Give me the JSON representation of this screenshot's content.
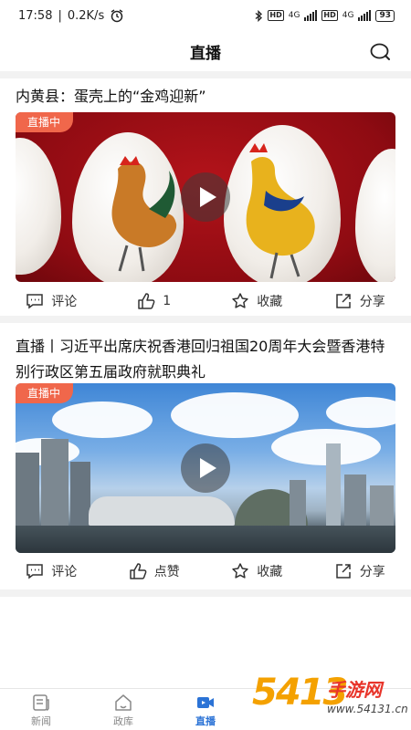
{
  "status_bar": {
    "time": "17:58",
    "speed": "0.2K/s",
    "network": "4G",
    "hd": "HD",
    "battery": "93"
  },
  "header": {
    "title": "直播",
    "search_icon": "search-icon"
  },
  "cards": [
    {
      "title": "内黄县：蛋壳上的“金鸡迎新”",
      "badge": "直播中",
      "actions": [
        {
          "label": "评论",
          "icon": "comment-icon"
        },
        {
          "label": "1",
          "icon": "thumbs-up-icon"
        },
        {
          "label": "收藏",
          "icon": "star-icon"
        },
        {
          "label": "分享",
          "icon": "share-icon"
        }
      ]
    },
    {
      "title": "直播丨习近平出席庆祝香港回归祖国20周年大会暨香港特别行政区第五届政府就职典礼",
      "badge": "直播中",
      "actions": [
        {
          "label": "评论",
          "icon": "comment-icon"
        },
        {
          "label": "点赞",
          "icon": "thumbs-up-icon"
        },
        {
          "label": "收藏",
          "icon": "star-icon"
        },
        {
          "label": "分享",
          "icon": "share-icon"
        }
      ]
    }
  ],
  "bottom_nav": [
    {
      "label": "新闻",
      "icon": "news-icon",
      "active": false
    },
    {
      "label": "政库",
      "icon": "home-icon",
      "active": false
    },
    {
      "label": "直播",
      "icon": "video-icon",
      "active": true
    }
  ],
  "watermark": {
    "number": "5413",
    "site": "手游网",
    "url": "www.54131.cn"
  },
  "colors": {
    "accent": "#2b73d6",
    "badge": "#f0674b"
  }
}
